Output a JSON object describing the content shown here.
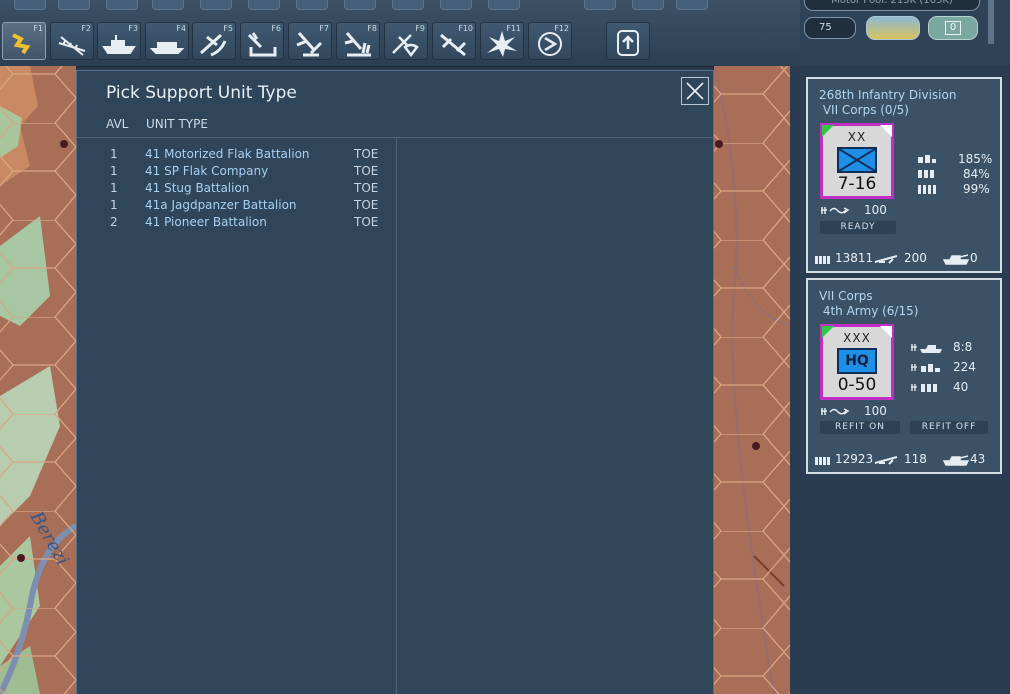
{
  "toolbar": {
    "buttons": [
      {
        "key": "F1",
        "icon": "move-icon",
        "active": true
      },
      {
        "key": "F2",
        "icon": "rail-icon"
      },
      {
        "key": "F3",
        "icon": "ship-icon"
      },
      {
        "key": "F4",
        "icon": "naval-transport-icon"
      },
      {
        "key": "F5",
        "icon": "air-recon-icon"
      },
      {
        "key": "F6",
        "icon": "airfield-icon"
      },
      {
        "key": "F7",
        "icon": "air-transport-icon"
      },
      {
        "key": "F8",
        "icon": "air-attack-icon"
      },
      {
        "key": "F9",
        "icon": "paradrop-icon"
      },
      {
        "key": "F10",
        "icon": "interdiction-icon"
      },
      {
        "key": "F11",
        "icon": "bombardment-icon"
      },
      {
        "key": "F12",
        "icon": "end-turn-icon"
      }
    ],
    "extra_button": "upload-icon"
  },
  "status": {
    "field_1": "75",
    "field_2": "0",
    "top_text": "Motor Pool: 215K (163K)"
  },
  "dialog": {
    "title": "Pick Support Unit Type",
    "col_avl": "AVL",
    "col_type": "UNIT TYPE",
    "rows": [
      {
        "avl": "1",
        "name": "41 Motorized Flak Battalion",
        "toe": "TOE"
      },
      {
        "avl": "1",
        "name": "41 SP Flak Company",
        "toe": "TOE"
      },
      {
        "avl": "1",
        "name": "41 Stug Battalion",
        "toe": "TOE"
      },
      {
        "avl": "1",
        "name": "41a Jagdpanzer Battalion",
        "toe": "TOE"
      },
      {
        "avl": "2",
        "name": "41 Pioneer Battalion",
        "toe": "TOE"
      }
    ]
  },
  "unit1": {
    "line1": "268th Infantry Division",
    "line2": " VII Corps (0/5)",
    "size": "XX",
    "strength": "7-16",
    "pct1": "185%",
    "pct2": "84%",
    "pct3": "99%",
    "supply": "100",
    "status": "READY",
    "men": "13811",
    "guns": "200",
    "afv": "0"
  },
  "unit2": {
    "line1": "VII Corps",
    "line2": " 4th Army (6/15)",
    "size": "XXX",
    "sym": "HQ",
    "strength": "0-50",
    "afv_ratio": "8:8",
    "mg": "224",
    "ammo": "40",
    "supply": "100",
    "refit_on": "REFIT ON",
    "refit_off": "REFIT OFF",
    "men": "12923",
    "guns": "118",
    "afv": "43"
  },
  "colors": {
    "accent": "#c22fc7",
    "unit_blue": "#1f8fe5",
    "link": "#a8d0f0"
  },
  "map": {
    "river_label": "Berezi"
  }
}
